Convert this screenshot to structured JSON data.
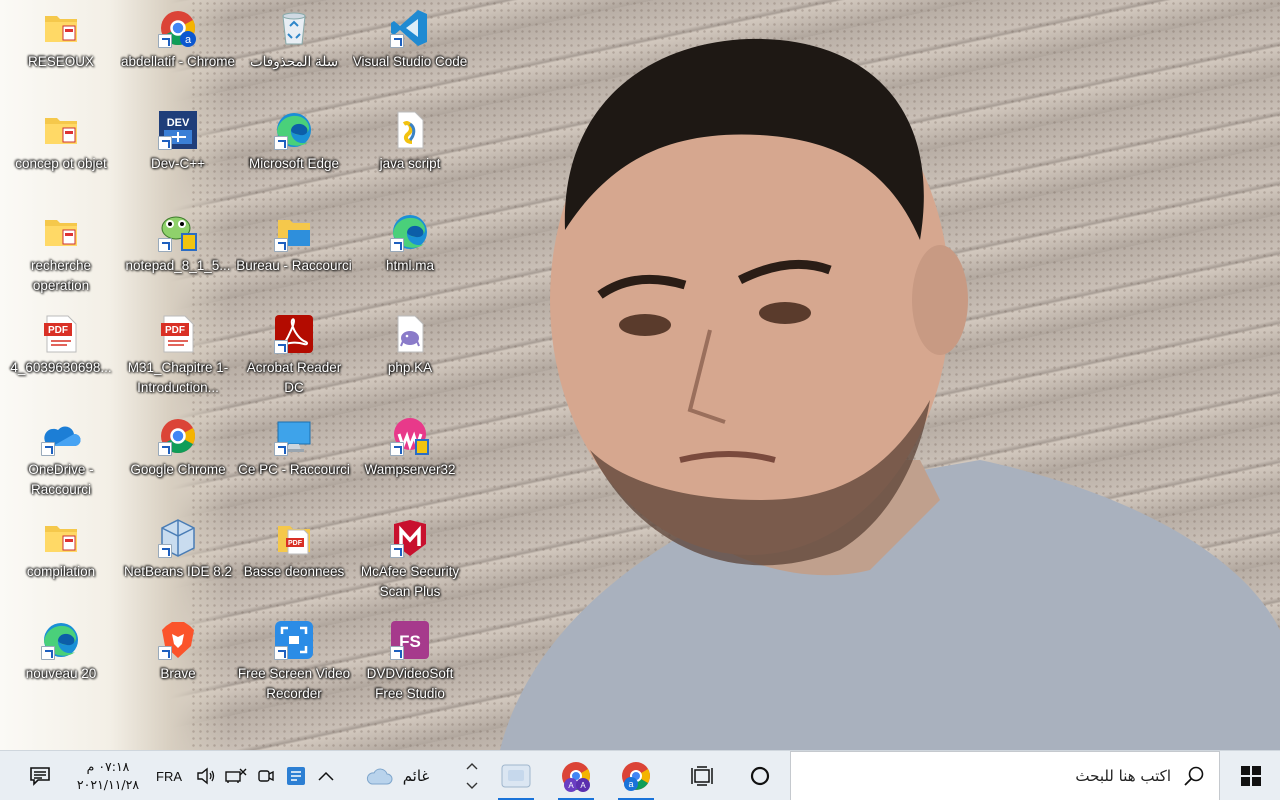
{
  "desktop": {
    "icons": [
      {
        "label": "RESEOUX",
        "icon": "folder-icon"
      },
      {
        "label": "abdellatif - Chrome",
        "icon": "chrome-profile-icon"
      },
      {
        "label": "سلة المحذوفات",
        "icon": "recycle-bin-icon"
      },
      {
        "label": "Visual Studio Code",
        "icon": "vscode-icon"
      },
      {
        "label": "concep ot objet",
        "icon": "folder-icon"
      },
      {
        "label": "Dev-C++",
        "icon": "devcpp-icon"
      },
      {
        "label": "Microsoft Edge",
        "icon": "edge-icon"
      },
      {
        "label": "java script",
        "icon": "js-file-icon"
      },
      {
        "label": "recherche operation",
        "icon": "folder-icon"
      },
      {
        "label": "notepad_8_1_5...",
        "icon": "notepad-installer-icon"
      },
      {
        "label": "Bureau - Raccourci",
        "icon": "folder-shortcut-icon"
      },
      {
        "label": "html.ma",
        "icon": "edge-icon"
      },
      {
        "label": "4_6039630698...",
        "icon": "pdf-icon"
      },
      {
        "label": "M31_Chapitre 1-Introduction...",
        "icon": "pdf-icon"
      },
      {
        "label": "Acrobat Reader DC",
        "icon": "acrobat-icon"
      },
      {
        "label": "php.KA",
        "icon": "php-file-icon"
      },
      {
        "label": "OneDrive - Raccourci",
        "icon": "onedrive-icon"
      },
      {
        "label": "Google Chrome",
        "icon": "chrome-icon"
      },
      {
        "label": "Ce PC - Raccourci",
        "icon": "this-pc-icon"
      },
      {
        "label": "Wampserver32",
        "icon": "wampserver-icon"
      },
      {
        "label": "compilation",
        "icon": "folder-icon"
      },
      {
        "label": "NetBeans IDE 8.2",
        "icon": "netbeans-icon"
      },
      {
        "label": "Basse deonnees",
        "icon": "pdf-folder-icon"
      },
      {
        "label": "McAfee Security Scan Plus",
        "icon": "mcafee-icon"
      },
      {
        "label": "nouveau 20",
        "icon": "edge-icon"
      },
      {
        "label": "Brave",
        "icon": "brave-icon"
      },
      {
        "label": "Free Screen Video Recorder",
        "icon": "screen-recorder-icon"
      },
      {
        "label": "DVDVideoSoft Free Studio",
        "icon": "dvdvideosoft-icon"
      }
    ]
  },
  "taskbar": {
    "search_placeholder": "اكتب هنا للبحث",
    "language": "FRA",
    "weather": "غائم",
    "clock_time": "٠٧:١٨ م",
    "clock_date": "٢٠٢١/١١/٢٨",
    "colors": {
      "background": "#e9eef3",
      "accent": "#1a73d9"
    }
  }
}
